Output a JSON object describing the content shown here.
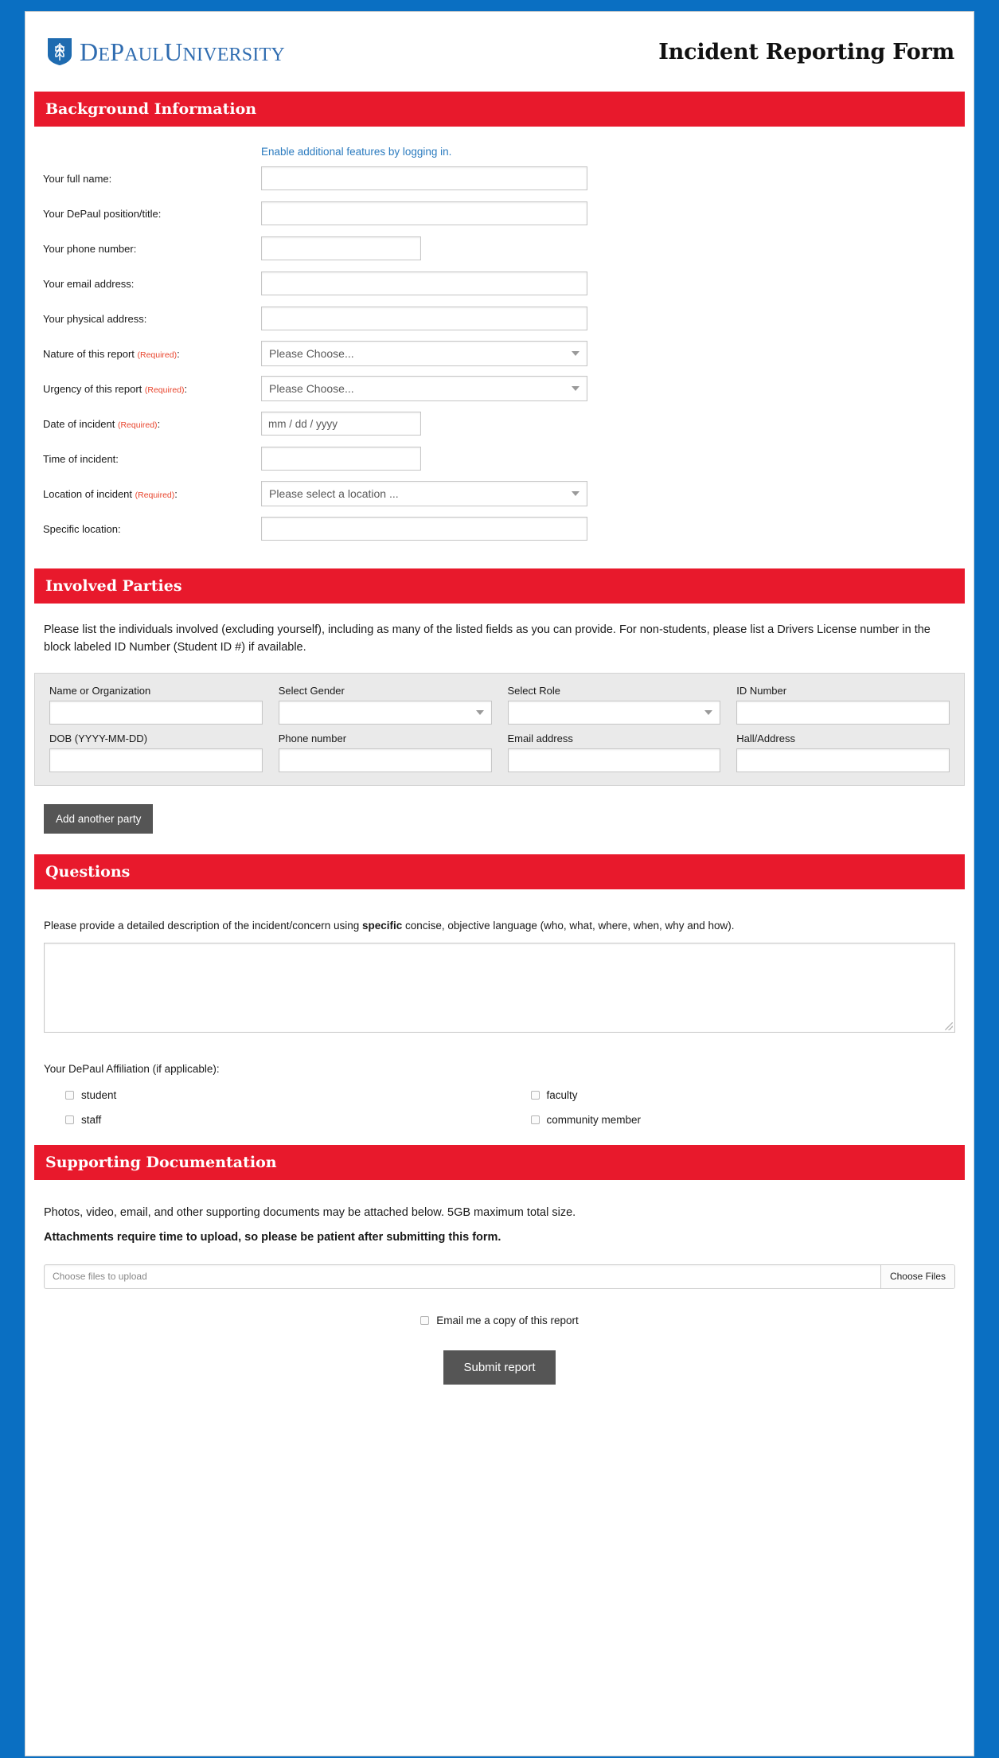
{
  "theme": {
    "page_background": "#0a6fc2",
    "section_bar": "#e8192c",
    "brand_blue": "#2f6cb0",
    "required_red": "#e8442c",
    "button_grey": "#555555",
    "party_box": "#eaeaea"
  },
  "header": {
    "logo_name": "depaul-shield-logo",
    "brand_text_1": "D",
    "brand_text_2": "E",
    "brand_text_3": "P",
    "brand_text_4": "AUL",
    "brand_text_5": "U",
    "brand_text_6": "NIVERSITY",
    "brand_full": "DePaul University",
    "document_title": "Incident Reporting Form"
  },
  "sections": {
    "background": "Background Information",
    "involved": "Involved Parties",
    "questions": "Questions",
    "documentation": "Supporting Documentation"
  },
  "background": {
    "login_link": "Enable additional features by logging in.",
    "required_marker": "(Required)",
    "fields": [
      {
        "label": "Your full name:",
        "type": "text",
        "width": "long",
        "value": ""
      },
      {
        "label": "Your DePaul position/title:",
        "type": "text",
        "width": "long",
        "value": ""
      },
      {
        "label": "Your phone number:",
        "type": "text",
        "width": "short",
        "value": ""
      },
      {
        "label": "Your email address:",
        "type": "text",
        "width": "long",
        "value": ""
      },
      {
        "label": "Your physical address:",
        "type": "text",
        "width": "long",
        "value": ""
      },
      {
        "label": "Nature of this report",
        "required": true,
        "type": "select",
        "width": "long",
        "value": "Please Choose..."
      },
      {
        "label": "Urgency of this report",
        "required": true,
        "type": "select",
        "width": "long",
        "value": "Please Choose..."
      },
      {
        "label": "Date of incident",
        "required": true,
        "type": "date",
        "width": "short",
        "value": "mm / dd / yyyy"
      },
      {
        "label": "Time of incident:",
        "type": "text",
        "width": "short",
        "value": ""
      },
      {
        "label": "Location of incident",
        "required": true,
        "type": "select",
        "width": "long",
        "value": "Please select a location ..."
      },
      {
        "label": "Specific location:",
        "type": "text",
        "width": "long",
        "value": ""
      }
    ]
  },
  "involved": {
    "instructions": "Please list the individuals involved (excluding yourself), including as many of the listed fields as you can provide. For non-students, please list a Drivers License number in the block labeled ID Number (Student ID #) if available.",
    "party_fields": [
      {
        "label": "Name or Organization",
        "type": "text",
        "value": ""
      },
      {
        "label": "Select Gender",
        "type": "select",
        "value": ""
      },
      {
        "label": "Select Role",
        "type": "select",
        "value": ""
      },
      {
        "label": "ID Number",
        "type": "text",
        "value": ""
      },
      {
        "label": "DOB (YYYY-MM-DD)",
        "type": "text",
        "value": ""
      },
      {
        "label": "Phone number",
        "type": "text",
        "value": ""
      },
      {
        "label": "Email address",
        "type": "text",
        "value": ""
      },
      {
        "label": "Hall/Address",
        "type": "text",
        "value": ""
      }
    ],
    "add_party_button": "Add another party"
  },
  "questions": {
    "description_prompt_a": "Please provide a detailed description of the incident/concern using ",
    "description_prompt_bold": "specific",
    "description_prompt_b": " concise, objective language (who, what, where, when, why and how).",
    "description_value": "",
    "affiliation_label": "Your DePaul Affiliation (if applicable):",
    "affiliation_options": [
      {
        "label": "student",
        "checked": false
      },
      {
        "label": "faculty",
        "checked": false
      },
      {
        "label": "staff",
        "checked": false
      },
      {
        "label": "community member",
        "checked": false
      }
    ]
  },
  "documentation": {
    "line1": "Photos, video, email, and other supporting documents may be attached below. 5GB maximum total size.",
    "line2_bold": "Attachments require time to upload, so please be patient after submitting this form.",
    "file_placeholder": "Choose files to upload",
    "choose_files_button": "Choose Files",
    "email_copy_label": "Email me a copy of this report",
    "email_copy_checked": false,
    "submit_button": "Submit report"
  }
}
